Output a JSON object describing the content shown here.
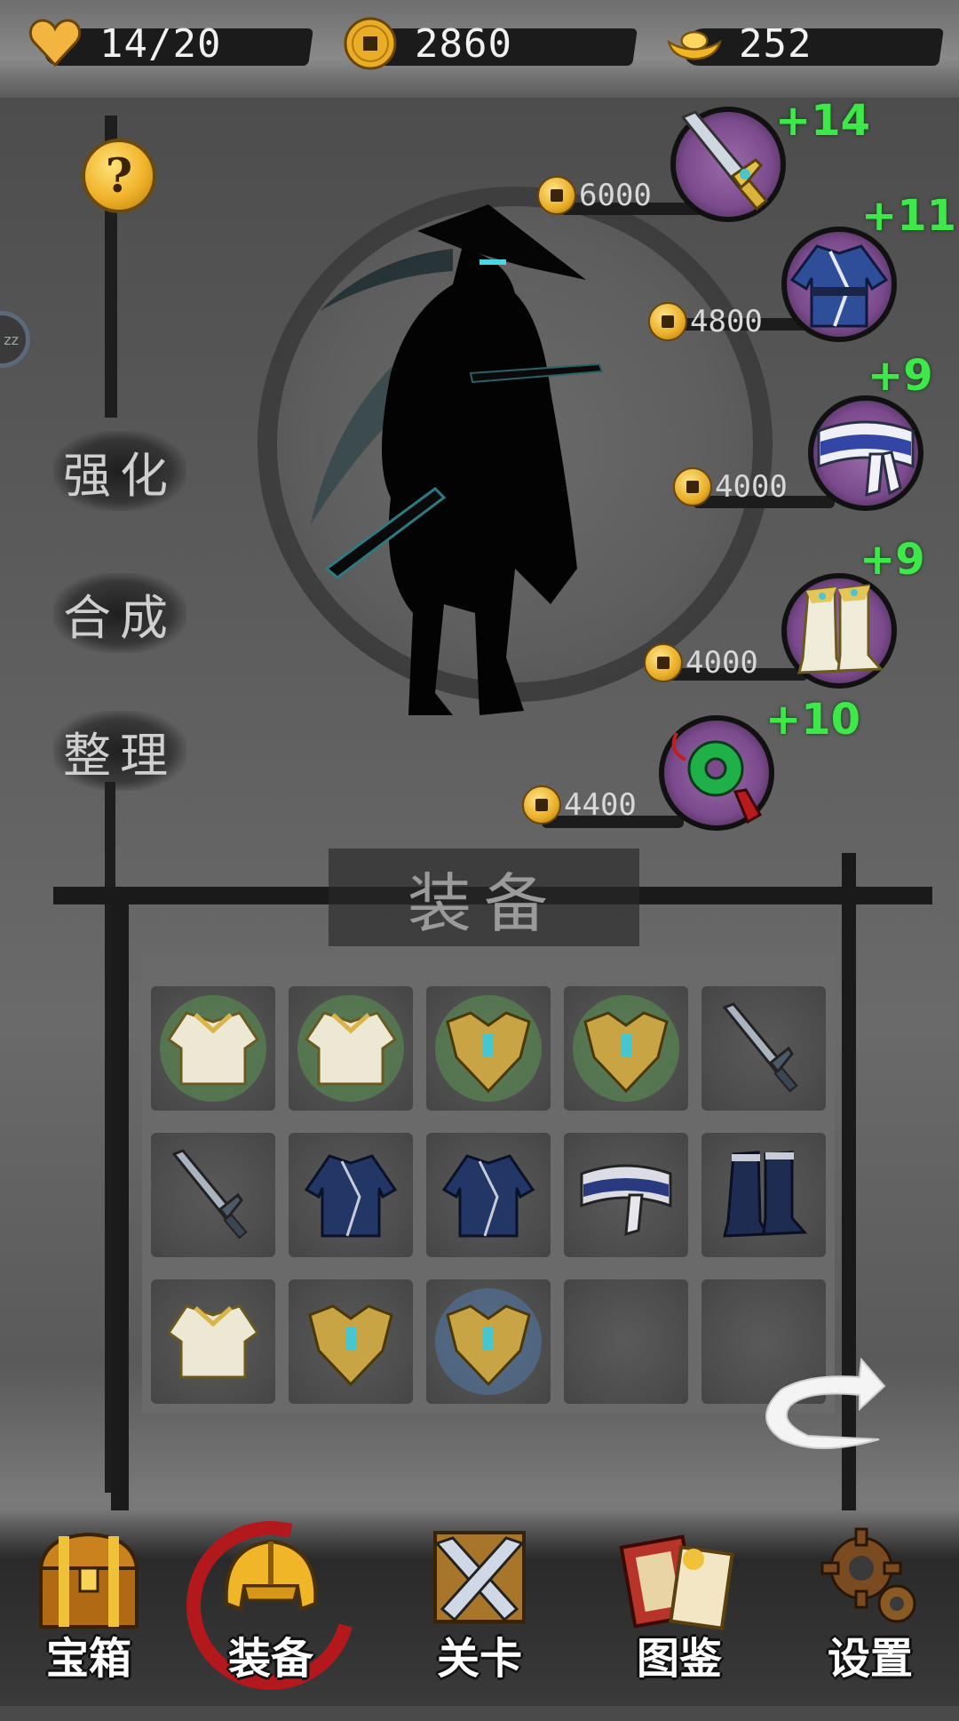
{
  "resources": {
    "stamina": {
      "value": "14/20",
      "icon": "heart-icon"
    },
    "coins": {
      "value": "2860",
      "icon": "coin-icon"
    },
    "ingots": {
      "value": "252",
      "icon": "gold-ingot-icon"
    }
  },
  "help_button": {
    "label": "?"
  },
  "side_menu": {
    "items": [
      {
        "label": "强化"
      },
      {
        "label": "合成"
      },
      {
        "label": "整理"
      }
    ]
  },
  "equipped_slots": [
    {
      "item": "sword-icon",
      "cost": "6000",
      "level": "+14"
    },
    {
      "item": "robe-icon",
      "cost": "4800",
      "level": "+11"
    },
    {
      "item": "belt-icon",
      "cost": "4000",
      "level": "+9"
    },
    {
      "item": "boots-icon",
      "cost": "4000",
      "level": "+9"
    },
    {
      "item": "jade-pendant-icon",
      "cost": "4400",
      "level": "+10"
    }
  ],
  "equipment_panel": {
    "title": "装备",
    "inventory": [
      [
        "white-armor-icon",
        "white-armor-icon",
        "gold-breastplate-icon",
        "gold-breastplate-icon",
        "sword-icon"
      ],
      [
        "sword-icon",
        "robe-icon",
        "robe-icon",
        "belt-icon",
        "boots-icon"
      ],
      [
        "white-armor-icon",
        "gold-breastplate-icon",
        "gold-breastplate-icon",
        "empty",
        "empty"
      ]
    ],
    "back_icon": "return-arrow-icon"
  },
  "bottom_nav": [
    {
      "label": "宝箱",
      "icon": "treasure-chest-icon"
    },
    {
      "label": "装备",
      "icon": "helmet-icon",
      "active": true
    },
    {
      "label": "关卡",
      "icon": "crossed-swords-icon"
    },
    {
      "label": "图鉴",
      "icon": "scroll-book-icon"
    },
    {
      "label": "设置",
      "icon": "gear-icon"
    }
  ],
  "colors": {
    "level_text": "#3fe84a",
    "coin": "#e9ad26",
    "slot_disc": "#7a4a8c",
    "active_nav_ring": "#b3181c"
  }
}
